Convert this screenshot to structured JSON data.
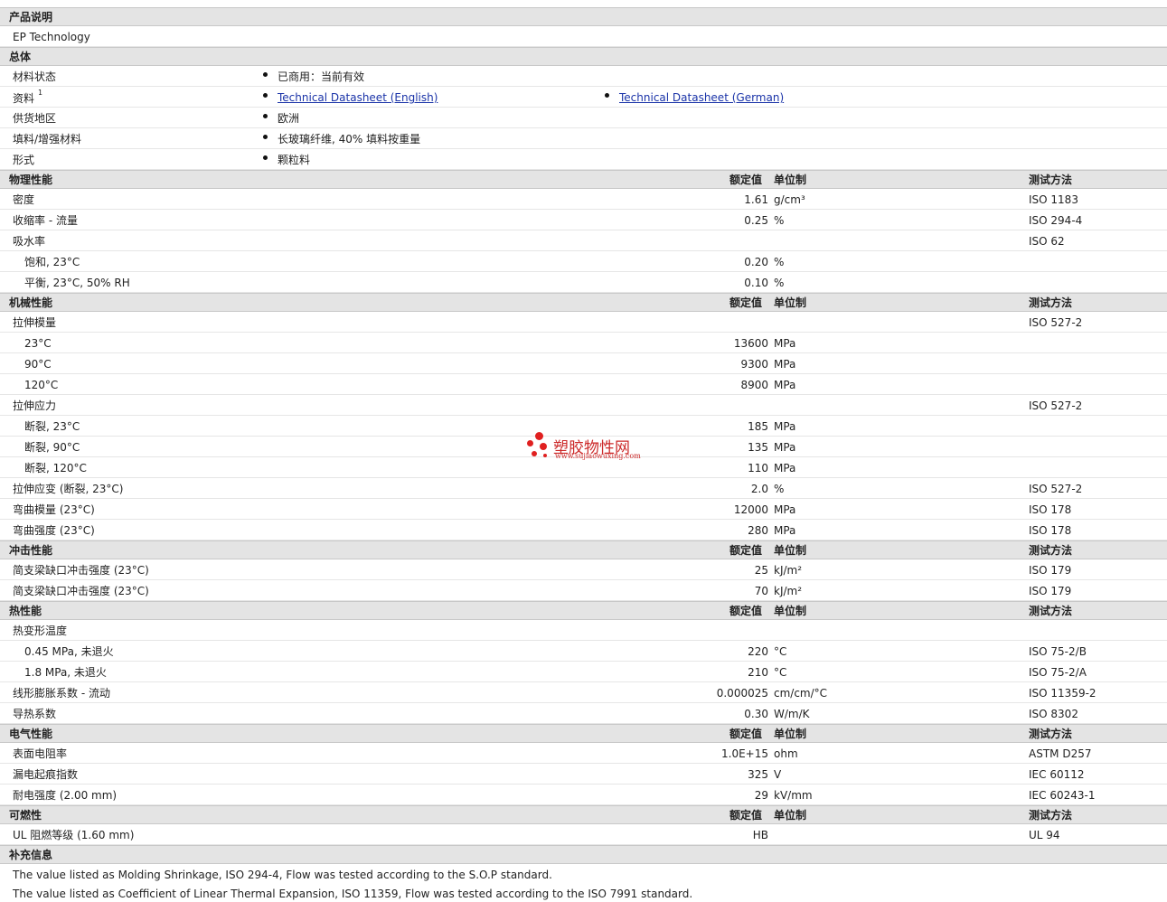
{
  "product": {
    "heading": "产品说明",
    "text": "EP Technology"
  },
  "general": {
    "heading": "总体",
    "rows": [
      {
        "name": "材料状态",
        "values": [
          "已商用：当前有效"
        ]
      },
      {
        "name": "资料",
        "sup": "1",
        "links": [
          "Technical Datasheet (English)",
          "Technical Datasheet (German)"
        ]
      },
      {
        "name": "供货地区",
        "values": [
          "欧洲"
        ]
      },
      {
        "name": "填料/增强材料",
        "values": [
          "长玻璃纤维, 40% 填料按重量"
        ]
      },
      {
        "name": "形式",
        "values": [
          "颗粒料"
        ]
      }
    ]
  },
  "columns": {
    "value": "额定值",
    "unit": "单位制",
    "test": "测试方法"
  },
  "sections": [
    {
      "heading": "物理性能",
      "rows": [
        {
          "name": "密度",
          "value": "1.61",
          "unit": "g/cm³",
          "test": "ISO 1183"
        },
        {
          "name": "收缩率 - 流量",
          "value": "0.25",
          "unit": "%",
          "test": "ISO 294-4"
        },
        {
          "name": "吸水率",
          "value": "",
          "unit": "",
          "test": "ISO 62"
        },
        {
          "name": "饱和, 23°C",
          "indent": true,
          "value": "0.20",
          "unit": "%",
          "test": ""
        },
        {
          "name": "平衡, 23°C, 50% RH",
          "indent": true,
          "value": "0.10",
          "unit": "%",
          "test": ""
        }
      ]
    },
    {
      "heading": "机械性能",
      "rows": [
        {
          "name": "拉伸模量",
          "value": "",
          "unit": "",
          "test": "ISO 527-2"
        },
        {
          "name": "23°C",
          "indent": true,
          "value": "13600",
          "unit": "MPa",
          "test": ""
        },
        {
          "name": "90°C",
          "indent": true,
          "value": "9300",
          "unit": "MPa",
          "test": ""
        },
        {
          "name": "120°C",
          "indent": true,
          "value": "8900",
          "unit": "MPa",
          "test": ""
        },
        {
          "name": "拉伸应力",
          "value": "",
          "unit": "",
          "test": "ISO 527-2"
        },
        {
          "name": "断裂, 23°C",
          "indent": true,
          "value": "185",
          "unit": "MPa",
          "test": ""
        },
        {
          "name": "断裂, 90°C",
          "indent": true,
          "value": "135",
          "unit": "MPa",
          "test": ""
        },
        {
          "name": "断裂, 120°C",
          "indent": true,
          "value": "110",
          "unit": "MPa",
          "test": ""
        },
        {
          "name": "拉伸应变 (断裂, 23°C)",
          "value": "2.0",
          "unit": "%",
          "test": "ISO 527-2"
        },
        {
          "name": "弯曲模量 (23°C)",
          "value": "12000",
          "unit": "MPa",
          "test": "ISO 178"
        },
        {
          "name": "弯曲强度 (23°C)",
          "value": "280",
          "unit": "MPa",
          "test": "ISO 178"
        }
      ]
    },
    {
      "heading": "冲击性能",
      "rows": [
        {
          "name": "简支梁缺口冲击强度 (23°C)",
          "value": "25",
          "unit": "kJ/m²",
          "test": "ISO 179"
        },
        {
          "name": "简支梁缺口冲击强度 (23°C)",
          "value": "70",
          "unit": "kJ/m²",
          "test": "ISO 179"
        }
      ]
    },
    {
      "heading": "热性能",
      "rows": [
        {
          "name": "热变形温度",
          "value": "",
          "unit": "",
          "test": ""
        },
        {
          "name": "0.45 MPa, 未退火",
          "indent": true,
          "value": "220",
          "unit": "°C",
          "test": "ISO 75-2/B"
        },
        {
          "name": "1.8 MPa, 未退火",
          "indent": true,
          "value": "210",
          "unit": "°C",
          "test": "ISO 75-2/A"
        },
        {
          "name": "线形膨胀系数 - 流动",
          "value": "0.000025",
          "unit": "cm/cm/°C",
          "test": "ISO 11359-2"
        },
        {
          "name": "导热系数",
          "value": "0.30",
          "unit": "W/m/K",
          "test": "ISO 8302"
        }
      ]
    },
    {
      "heading": "电气性能",
      "rows": [
        {
          "name": "表面电阻率",
          "value": "1.0E+15",
          "unit": "ohm",
          "test": "ASTM D257"
        },
        {
          "name": "漏电起痕指数",
          "value": "325",
          "unit": "V",
          "test": "IEC 60112"
        },
        {
          "name": "耐电强度 (2.00 mm)",
          "value": "29",
          "unit": "kV/mm",
          "test": "IEC 60243-1"
        }
      ]
    },
    {
      "heading": "可燃性",
      "rows": [
        {
          "name": "UL 阻燃等级 (1.60 mm)",
          "value": "HB",
          "unit": "",
          "test": "UL 94"
        }
      ]
    }
  ],
  "supplementary": {
    "heading": "补充信息",
    "notes": [
      "The value listed as Molding Shrinkage, ISO 294-4, Flow was tested according to the S.O.P standard.",
      "The value listed as Coefficient of Linear Thermal Expansion, ISO 11359, Flow was tested according to the ISO 7991 standard."
    ]
  },
  "watermark": {
    "cn": "塑胶物性网",
    "en": "www.sujiaowuxing.com",
    "color": "#cc2a2a"
  }
}
